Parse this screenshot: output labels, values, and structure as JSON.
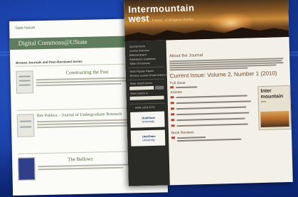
{
  "back_page": {
    "logo": "State Nature",
    "header_title": "Digital Commons@UState",
    "subheading": "Browse Journals and Peer-Reviewed Series",
    "entries": [
      {
        "title": "Constructing the Past"
      },
      {
        "title": "Bee Publica – Journal of Undergraduate Research"
      },
      {
        "title": "The Bellows"
      }
    ]
  },
  "front_page": {
    "title_line1": "Inter",
    "title_line1b": "mountain",
    "title_line2": "west",
    "title_journal": "Journal",
    "title_of": "of Religious Studies",
    "sidebar": {
      "links": [
        "Journal Home",
        "Journal Overview",
        "Editorial Board",
        "Submission Guidelines",
        "Table Of Contents"
      ],
      "extra_links": [
        "Most Popular Papers",
        "Receive Custom Email Notices or RSS"
      ],
      "search_label": "Enter search terms:",
      "search_in_label": "Enter search in:",
      "issn_label": "ISSN: 2154-5776",
      "logo1_line1": "UtahState",
      "logo1_line2": "University",
      "logo2_line1": "UtahState",
      "logo2_line2": "University"
    },
    "content": {
      "about_heading": "About the Journal",
      "issue_heading": "Current Issue: Volume 2, Number 1 (2010)",
      "sections": [
        "Full Issue",
        "Articles",
        "Book Reviews"
      ],
      "cover_title1": "Inter",
      "cover_title2": "mountain",
      "cover_sub": "west"
    }
  },
  "colors": {
    "background": "#1a3f9c",
    "dc_green": "#5f7d5c",
    "iw_sidebar": "#2a2a26",
    "iw_heading": "#6b4a2a",
    "iw_banner": "#c98a3a"
  }
}
